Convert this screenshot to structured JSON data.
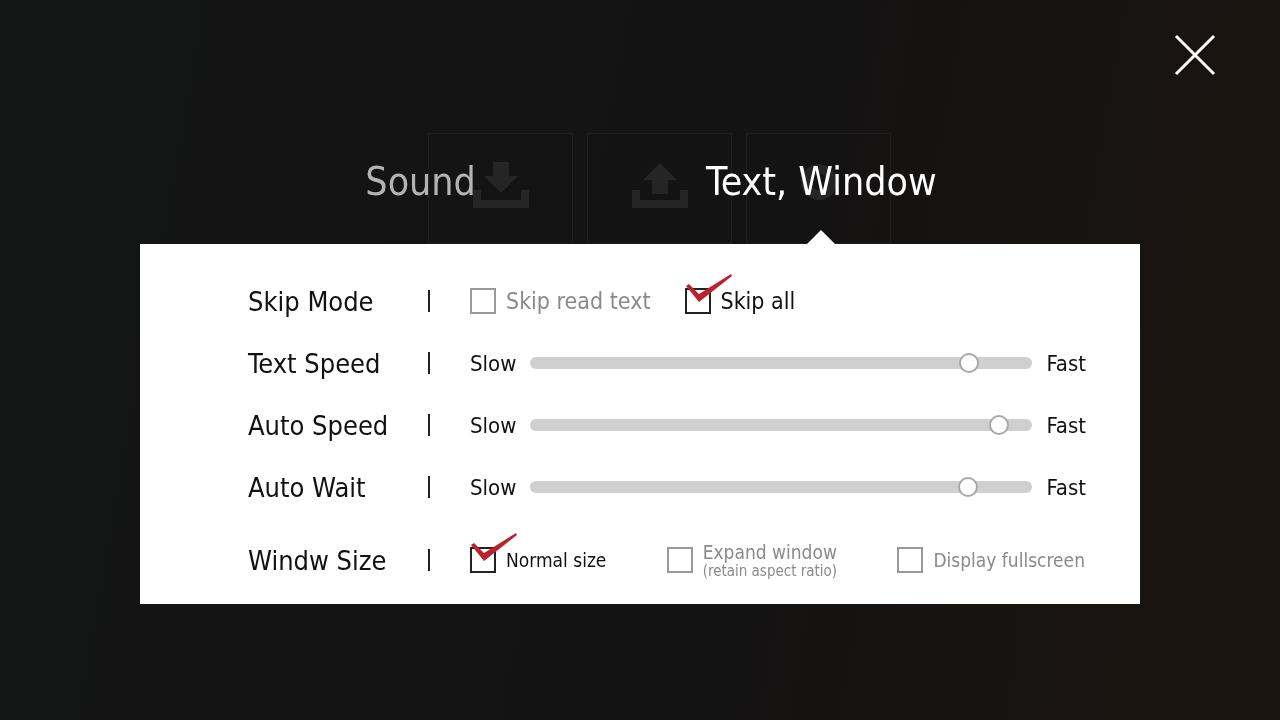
{
  "tabs": [
    {
      "label": "Sound",
      "selected": false
    },
    {
      "label": "Text, Window",
      "selected": true
    }
  ],
  "settings": [
    {
      "kind": "checkboxes",
      "label": "Skip Mode",
      "options": [
        {
          "label": "Skip read text",
          "checked": false
        },
        {
          "label": "Skip all",
          "checked": true
        }
      ]
    },
    {
      "kind": "slider",
      "label": "Text Speed",
      "min_label": "Slow",
      "max_label": "Fast",
      "level": 0.873
    },
    {
      "kind": "slider",
      "label": "Auto Speed",
      "min_label": "Slow",
      "max_label": "Fast",
      "level": 0.933
    },
    {
      "kind": "slider",
      "label": "Auto Wait",
      "min_label": "Slow",
      "max_label": "Fast",
      "level": 0.871
    },
    {
      "kind": "checkboxes",
      "label": "Windw Size",
      "options": [
        {
          "label": "Normal size",
          "checked": true
        },
        {
          "label": "Expand window",
          "note": "(retain aspect ratio)",
          "checked": false
        },
        {
          "label": "Display fullscreen",
          "checked": false
        }
      ]
    }
  ]
}
